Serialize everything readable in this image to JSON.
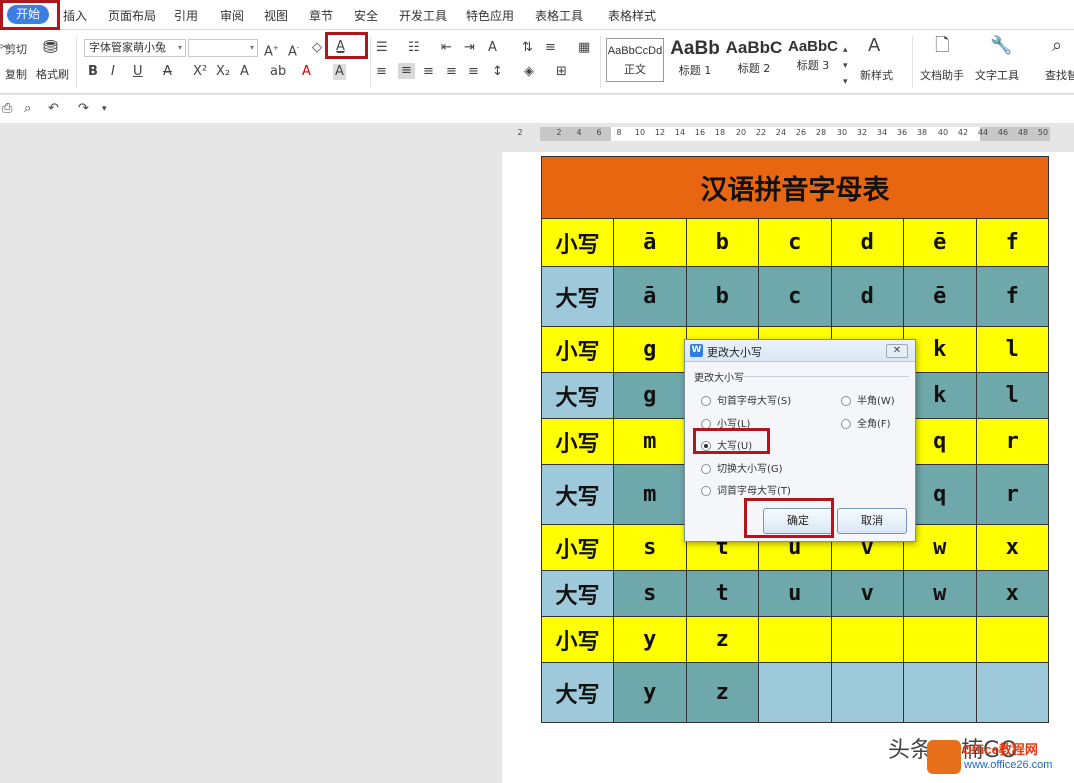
{
  "menu": {
    "tabs": [
      "开始",
      "插入",
      "页面布局",
      "引用",
      "审阅",
      "视图",
      "章节",
      "安全",
      "开发工具",
      "特色应用",
      "表格工具",
      "表格样式"
    ]
  },
  "ribbon": {
    "cut": "剪切",
    "copy": "复制",
    "format_painter": "格式刷",
    "font_name": "字体管家萌小兔",
    "font_size": "",
    "styles": [
      {
        "sample": "AaBbCcDd",
        "name": "正文"
      },
      {
        "sample": "AaBb",
        "name": "标题 1"
      },
      {
        "sample": "AaBbC",
        "name": "标题 2"
      },
      {
        "sample": "AaBbC",
        "name": "标题 3"
      }
    ],
    "new_style": "新样式",
    "doc_assistant": "文档助手",
    "text_tools": "文字工具",
    "find": "查找替"
  },
  "ruler": {
    "ticks": [
      "2",
      "2",
      "4",
      "6",
      "8",
      "10",
      "12",
      "14",
      "16",
      "18",
      "20",
      "22",
      "24",
      "26",
      "28",
      "30",
      "32",
      "34",
      "36",
      "38",
      "40",
      "42",
      "44",
      "46",
      "48",
      "50"
    ]
  },
  "table": {
    "title": "汉语拼音字母表",
    "rows": [
      {
        "label": "小写",
        "cells": [
          "ā",
          "b",
          "c",
          "d",
          "ē",
          "f"
        ],
        "style": "yellow"
      },
      {
        "label": "大写",
        "cells": [
          "ā",
          "b",
          "c",
          "d",
          "ē",
          "f"
        ],
        "style": "blue"
      },
      {
        "label": "小写",
        "cells": [
          "g",
          "",
          "",
          "",
          "k",
          "l"
        ],
        "style": "yellow"
      },
      {
        "label": "大写",
        "cells": [
          "g",
          "",
          "",
          "",
          "k",
          "l"
        ],
        "style": "blue"
      },
      {
        "label": "小写",
        "cells": [
          "m",
          "",
          "",
          "",
          "q",
          "r"
        ],
        "style": "yellow"
      },
      {
        "label": "大写",
        "cells": [
          "m",
          "",
          "",
          "",
          "q",
          "r"
        ],
        "style": "blue"
      },
      {
        "label": "小写",
        "cells": [
          "s",
          "t",
          "u",
          "v",
          "w",
          "x"
        ],
        "style": "yellow"
      },
      {
        "label": "大写",
        "cells": [
          "s",
          "t",
          "u",
          "v",
          "w",
          "x"
        ],
        "style": "blue"
      },
      {
        "label": "小写",
        "cells": [
          "y",
          "z",
          "",
          "",
          "",
          ""
        ],
        "style": "yellow"
      },
      {
        "label": "大写",
        "cells": [
          "y",
          "z",
          "",
          "",
          "",
          ""
        ],
        "style": "blue"
      }
    ]
  },
  "dialog": {
    "title": "更改大小写",
    "group_label": "更改大小写",
    "options_left": [
      "句首字母大写(S)",
      "小写(L)",
      "大写(U)",
      "切换大小写(G)",
      "词首字母大写(T)"
    ],
    "options_right": [
      "半角(W)",
      "全角(F)"
    ],
    "selected": "大写(U)",
    "ok": "确定",
    "cancel": "取消"
  },
  "watermark": {
    "text": "头条 @楠GO",
    "site_name": "Office教程网",
    "site_url": "www.office26.com"
  },
  "colors": {
    "accent": "#3d7fe0",
    "highlight": "#b3151d",
    "title_bg": "#e8660f",
    "yellow_row": "#ffff00",
    "teal_cell": "#6fa8aa",
    "light_blue": "#9ec9da"
  }
}
